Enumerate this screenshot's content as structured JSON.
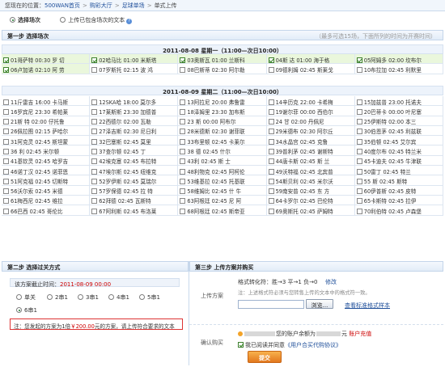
{
  "breadcrumb": {
    "prefix": "您现在的位置：",
    "items": [
      "500WAN首页",
      "购彩大厅",
      "足球单场",
      "单式上传"
    ]
  },
  "modes": [
    {
      "label": "选择场次",
      "selected": true
    },
    {
      "label": "上传已包含场次的文本",
      "selected": false
    }
  ],
  "step1": {
    "title": "第一步  选择场次",
    "note": "（最多可选15场，下面所列的时间为开赛时间）"
  },
  "days": [
    {
      "title": "2011-08-08  星期一（11:00—次日10:00）",
      "matches": [
        {
          "label": "01哥萨特 00:30 罗 切",
          "checked": true
        },
        {
          "label": "02哈马比 01:00 米斯塔",
          "checked": true
        },
        {
          "label": "03奥斯瓦 01:00 兰斯科",
          "checked": true
        },
        {
          "label": "04斯 达 01:00 海于格",
          "checked": true
        },
        {
          "label": "05阿姆多 02:00 坎布尔",
          "checked": true
        },
        {
          "label": "06卢加诺 02:10 阿 劳",
          "checked": true
        },
        {
          "label": "07罗斯托 02:15 波 鸿",
          "checked": false
        },
        {
          "label": "08巴斯蒂 02:30 阿尔勒",
          "checked": false
        },
        {
          "label": "09德利姆 02:45 斯莱戈",
          "checked": false
        },
        {
          "label": "10布拉加 02:45 利默里",
          "checked": false
        }
      ]
    },
    {
      "title": "2011-08-09  星期二（11:00—次日10:00）",
      "matches": [
        {
          "label": "11斤雷吉 16:00 卡马斯",
          "checked": false
        },
        {
          "label": "12SKA哈 18:00 莫尔多",
          "checked": false
        },
        {
          "label": "13阿拉尼 20:00 弗鲁雷",
          "checked": false
        },
        {
          "label": "14辛历克 22:00 卡希梅",
          "checked": false
        },
        {
          "label": "15加兹普 23:00 托诺夫",
          "checked": false
        },
        {
          "label": "16罗宾尼 23:30 希帕莱",
          "checked": false
        },
        {
          "label": "17莱斯斯 23:30 加德普",
          "checked": false
        },
        {
          "label": "18泽姆里 23:30 加布斯",
          "checked": false
        },
        {
          "label": "19谢尔菲 00:00 西伯尔",
          "checked": false
        },
        {
          "label": "20巴蒂卡 00:00 叶尼塞",
          "checked": false
        },
        {
          "label": "21斯 特 02:00 仔托鲁",
          "checked": false
        },
        {
          "label": "22西德尔 02:00 瓦勒",
          "checked": false
        },
        {
          "label": "23 斯 00:00 阿布尔",
          "checked": false
        },
        {
          "label": "24 甘 02:00 丹佩尼",
          "checked": false
        },
        {
          "label": "25伊斯特 02:00 本三",
          "checked": false
        },
        {
          "label": "26佩拉图 02:15 萨哈尔",
          "checked": false
        },
        {
          "label": "27泽吉斯 02:30 尼日利",
          "checked": false
        },
        {
          "label": "28米德斯 02:30 谢菲联",
          "checked": false
        },
        {
          "label": "29米德布 02:30 阿尔丘",
          "checked": false
        },
        {
          "label": "30伯恩茅 02:45 利兹联",
          "checked": false
        },
        {
          "label": "31阿克灵 02:45 斯坦蒙",
          "checked": false
        },
        {
          "label": "32巴塞斯 02:45 莫里",
          "checked": false
        },
        {
          "label": "33布里顿 02:45 卡莱尔",
          "checked": false
        },
        {
          "label": "34水晶宫 02:45 克鲁",
          "checked": false
        },
        {
          "label": "35伯顿 02:45 艾尔宾",
          "checked": false
        },
        {
          "label": "36 利 02:45 米尔顿",
          "checked": false
        },
        {
          "label": "37查尔顿 02:45 丁",
          "checked": false
        },
        {
          "label": "38 德 02:45 什尔",
          "checked": false
        },
        {
          "label": "39普利茅 02:45 谢斯特",
          "checked": false
        },
        {
          "label": "40度尔布 02:45 特兰米",
          "checked": false
        },
        {
          "label": "41基钦灵 02:45 哈罗吉",
          "checked": false
        },
        {
          "label": "42埃克塞 02:45 布拉特",
          "checked": false
        },
        {
          "label": "43利 02:45 斯 士",
          "checked": false
        },
        {
          "label": "44唐卡斯 02:45 斯 兰",
          "checked": false
        },
        {
          "label": "45卡迪夫 02:45 牛津联",
          "checked": false
        },
        {
          "label": "46诺丁汉 02:45 诺菲恩",
          "checked": false
        },
        {
          "label": "47埃尔斯 02:45 纽维克",
          "checked": false
        },
        {
          "label": "48利物克 02:45 阿柯伦",
          "checked": false
        },
        {
          "label": "49沃特福 02:45 北宾普",
          "checked": false
        },
        {
          "label": "50雷丁 02:45 特兰",
          "checked": false
        },
        {
          "label": "51阿克福 02:45 切斯特",
          "checked": false
        },
        {
          "label": "52罗伊斯 02:45 莫瑞尔",
          "checked": false
        },
        {
          "label": "53维基拉 02:45 托基联",
          "checked": false
        },
        {
          "label": "54斯贝利 02:45 米尔沃",
          "checked": false
        },
        {
          "label": "55 斯 02:45 斯特",
          "checked": false
        },
        {
          "label": "56沃尔索 02:45 米德",
          "checked": false
        },
        {
          "label": "57罗保德 02:45 拉 特",
          "checked": false
        },
        {
          "label": "58维姆比 02:45 什 牛",
          "checked": false
        },
        {
          "label": "59南安普 02:45 东 方",
          "checked": false
        },
        {
          "label": "60伊普斯 02:45 皮特",
          "checked": false
        },
        {
          "label": "61梅西尼 02:45 维拉",
          "checked": false
        },
        {
          "label": "62拜德 02:45 瓦斯特",
          "checked": false
        },
        {
          "label": "63阿根廷 02:45 尼 阿",
          "checked": false
        },
        {
          "label": "64卡罗尔 02:45 巴伦特",
          "checked": false
        },
        {
          "label": "65卡斯特 02:45 拉伊",
          "checked": false
        },
        {
          "label": "66巴西 02:45 哥伦比",
          "checked": false
        },
        {
          "label": "67阿利斯 02:45 布洛莱",
          "checked": false
        },
        {
          "label": "68阿根廷 02:45 斯帝亚",
          "checked": false
        },
        {
          "label": "69奥斯托 02:45 萨姆特",
          "checked": false
        },
        {
          "label": "70利伯特 02:45 卢森堡",
          "checked": false
        }
      ]
    }
  ],
  "step2": {
    "title": "第二步  选择过关方式",
    "deadline_label": "该方案截止时间：",
    "deadline_value": "2011-08-09 00:00",
    "options": [
      {
        "label": "单关",
        "selected": false
      },
      {
        "label": "2串1",
        "selected": false
      },
      {
        "label": "3串1",
        "selected": false
      },
      {
        "label": "4串1",
        "selected": false
      },
      {
        "label": "5串1",
        "selected": false
      },
      {
        "label": "6串1",
        "selected": true
      }
    ],
    "warning_pre": "注：您发起的方案为1倍",
    "warning_amount": "￥200.00",
    "warning_post": "元的方案，请上传符合要求的文本"
  },
  "step3": {
    "title": "第三步  上传方案并购买",
    "upload_label": "上传方案",
    "format_label": "格式转化符：胜→3 平→1 负→0",
    "modify_link": "修改",
    "hint": "注：上述格式符必须与您转售上传的文本中的格式符一致。",
    "browse_label": "浏览...",
    "sample_link": "查看标准格式样本",
    "confirm_label": "确认购买",
    "balance_pre": "您的账户余额为",
    "balance_unit": "元",
    "recharge_link": "账户充值",
    "agree_pre": "我已阅读并同意",
    "agree_link": "《用户合买代购协议》",
    "submit_label": "提交"
  }
}
